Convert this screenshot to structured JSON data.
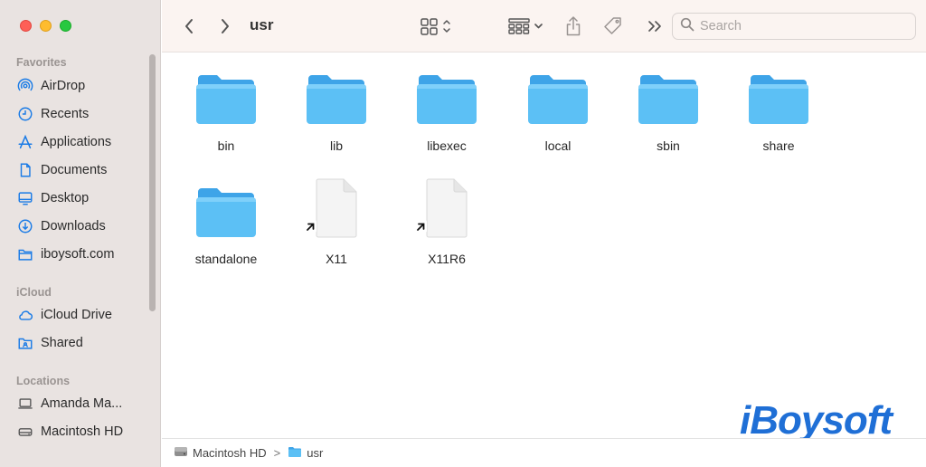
{
  "window": {
    "title": "usr"
  },
  "sidebar": {
    "sections": [
      {
        "label": "Favorites",
        "items": [
          {
            "label": "AirDrop",
            "icon": "airdrop-icon"
          },
          {
            "label": "Recents",
            "icon": "clock-icon"
          },
          {
            "label": "Applications",
            "icon": "applications-icon"
          },
          {
            "label": "Documents",
            "icon": "document-icon"
          },
          {
            "label": "Desktop",
            "icon": "desktop-icon"
          },
          {
            "label": "Downloads",
            "icon": "download-icon"
          },
          {
            "label": "iboysoft.com",
            "icon": "folder-icon"
          }
        ]
      },
      {
        "label": "iCloud",
        "items": [
          {
            "label": "iCloud Drive",
            "icon": "cloud-icon"
          },
          {
            "label": "Shared",
            "icon": "shared-folder-icon"
          }
        ]
      },
      {
        "label": "Locations",
        "items": [
          {
            "label": "Amanda Ma...",
            "icon": "laptop-icon"
          },
          {
            "label": "Macintosh HD",
            "icon": "disk-icon"
          }
        ]
      }
    ]
  },
  "toolbar": {
    "search_placeholder": "Search"
  },
  "items": [
    {
      "name": "bin",
      "kind": "folder"
    },
    {
      "name": "lib",
      "kind": "folder"
    },
    {
      "name": "libexec",
      "kind": "folder"
    },
    {
      "name": "local",
      "kind": "folder"
    },
    {
      "name": "sbin",
      "kind": "folder"
    },
    {
      "name": "share",
      "kind": "folder"
    },
    {
      "name": "standalone",
      "kind": "folder"
    },
    {
      "name": "X11",
      "kind": "alias"
    },
    {
      "name": "X11R6",
      "kind": "alias"
    }
  ],
  "pathbar": {
    "crumbs": [
      {
        "label": "Macintosh HD",
        "icon": "disk-icon"
      },
      {
        "label": "usr",
        "icon": "folder-icon"
      }
    ],
    "separator": ">"
  },
  "watermark": {
    "text": "iBoysoft"
  },
  "colors": {
    "accent": "#1a7be6",
    "folder": "#5cc0f5",
    "sidebar": "#e9e3e1",
    "toolbar": "#fbf4f1"
  }
}
